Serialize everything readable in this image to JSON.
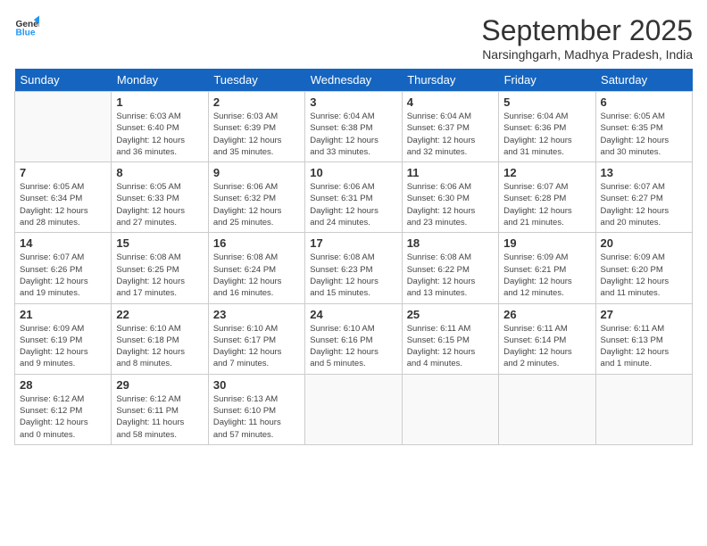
{
  "header": {
    "logo_line1": "General",
    "logo_line2": "Blue",
    "month": "September 2025",
    "location": "Narsinghgarh, Madhya Pradesh, India"
  },
  "days_of_week": [
    "Sunday",
    "Monday",
    "Tuesday",
    "Wednesday",
    "Thursday",
    "Friday",
    "Saturday"
  ],
  "weeks": [
    [
      {
        "num": "",
        "info": ""
      },
      {
        "num": "1",
        "info": "Sunrise: 6:03 AM\nSunset: 6:40 PM\nDaylight: 12 hours\nand 36 minutes."
      },
      {
        "num": "2",
        "info": "Sunrise: 6:03 AM\nSunset: 6:39 PM\nDaylight: 12 hours\nand 35 minutes."
      },
      {
        "num": "3",
        "info": "Sunrise: 6:04 AM\nSunset: 6:38 PM\nDaylight: 12 hours\nand 33 minutes."
      },
      {
        "num": "4",
        "info": "Sunrise: 6:04 AM\nSunset: 6:37 PM\nDaylight: 12 hours\nand 32 minutes."
      },
      {
        "num": "5",
        "info": "Sunrise: 6:04 AM\nSunset: 6:36 PM\nDaylight: 12 hours\nand 31 minutes."
      },
      {
        "num": "6",
        "info": "Sunrise: 6:05 AM\nSunset: 6:35 PM\nDaylight: 12 hours\nand 30 minutes."
      }
    ],
    [
      {
        "num": "7",
        "info": "Sunrise: 6:05 AM\nSunset: 6:34 PM\nDaylight: 12 hours\nand 28 minutes."
      },
      {
        "num": "8",
        "info": "Sunrise: 6:05 AM\nSunset: 6:33 PM\nDaylight: 12 hours\nand 27 minutes."
      },
      {
        "num": "9",
        "info": "Sunrise: 6:06 AM\nSunset: 6:32 PM\nDaylight: 12 hours\nand 25 minutes."
      },
      {
        "num": "10",
        "info": "Sunrise: 6:06 AM\nSunset: 6:31 PM\nDaylight: 12 hours\nand 24 minutes."
      },
      {
        "num": "11",
        "info": "Sunrise: 6:06 AM\nSunset: 6:30 PM\nDaylight: 12 hours\nand 23 minutes."
      },
      {
        "num": "12",
        "info": "Sunrise: 6:07 AM\nSunset: 6:28 PM\nDaylight: 12 hours\nand 21 minutes."
      },
      {
        "num": "13",
        "info": "Sunrise: 6:07 AM\nSunset: 6:27 PM\nDaylight: 12 hours\nand 20 minutes."
      }
    ],
    [
      {
        "num": "14",
        "info": "Sunrise: 6:07 AM\nSunset: 6:26 PM\nDaylight: 12 hours\nand 19 minutes."
      },
      {
        "num": "15",
        "info": "Sunrise: 6:08 AM\nSunset: 6:25 PM\nDaylight: 12 hours\nand 17 minutes."
      },
      {
        "num": "16",
        "info": "Sunrise: 6:08 AM\nSunset: 6:24 PM\nDaylight: 12 hours\nand 16 minutes."
      },
      {
        "num": "17",
        "info": "Sunrise: 6:08 AM\nSunset: 6:23 PM\nDaylight: 12 hours\nand 15 minutes."
      },
      {
        "num": "18",
        "info": "Sunrise: 6:08 AM\nSunset: 6:22 PM\nDaylight: 12 hours\nand 13 minutes."
      },
      {
        "num": "19",
        "info": "Sunrise: 6:09 AM\nSunset: 6:21 PM\nDaylight: 12 hours\nand 12 minutes."
      },
      {
        "num": "20",
        "info": "Sunrise: 6:09 AM\nSunset: 6:20 PM\nDaylight: 12 hours\nand 11 minutes."
      }
    ],
    [
      {
        "num": "21",
        "info": "Sunrise: 6:09 AM\nSunset: 6:19 PM\nDaylight: 12 hours\nand 9 minutes."
      },
      {
        "num": "22",
        "info": "Sunrise: 6:10 AM\nSunset: 6:18 PM\nDaylight: 12 hours\nand 8 minutes."
      },
      {
        "num": "23",
        "info": "Sunrise: 6:10 AM\nSunset: 6:17 PM\nDaylight: 12 hours\nand 7 minutes."
      },
      {
        "num": "24",
        "info": "Sunrise: 6:10 AM\nSunset: 6:16 PM\nDaylight: 12 hours\nand 5 minutes."
      },
      {
        "num": "25",
        "info": "Sunrise: 6:11 AM\nSunset: 6:15 PM\nDaylight: 12 hours\nand 4 minutes."
      },
      {
        "num": "26",
        "info": "Sunrise: 6:11 AM\nSunset: 6:14 PM\nDaylight: 12 hours\nand 2 minutes."
      },
      {
        "num": "27",
        "info": "Sunrise: 6:11 AM\nSunset: 6:13 PM\nDaylight: 12 hours\nand 1 minute."
      }
    ],
    [
      {
        "num": "28",
        "info": "Sunrise: 6:12 AM\nSunset: 6:12 PM\nDaylight: 12 hours\nand 0 minutes."
      },
      {
        "num": "29",
        "info": "Sunrise: 6:12 AM\nSunset: 6:11 PM\nDaylight: 11 hours\nand 58 minutes."
      },
      {
        "num": "30",
        "info": "Sunrise: 6:13 AM\nSunset: 6:10 PM\nDaylight: 11 hours\nand 57 minutes."
      },
      {
        "num": "",
        "info": ""
      },
      {
        "num": "",
        "info": ""
      },
      {
        "num": "",
        "info": ""
      },
      {
        "num": "",
        "info": ""
      }
    ]
  ]
}
